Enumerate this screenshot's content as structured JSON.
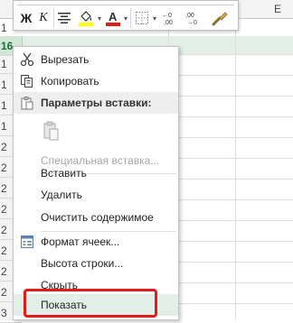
{
  "spreadsheet": {
    "column_visible": "E",
    "rows": [
      "1",
      "16",
      "1",
      "1",
      "1",
      "1",
      "2",
      "2",
      "2",
      "2",
      "2",
      "2",
      "2",
      "2",
      "3",
      "3"
    ],
    "selected_row": "16"
  },
  "toolbar": {
    "bold": "Ж",
    "italic": "К",
    "increase_decimal": "⁺₀₀",
    "decrease_decimal": "₀₀",
    "font_color_glyph": "А"
  },
  "menu": {
    "cut": "Вырезать",
    "copy": "Копировать",
    "paste_options": "Параметры вставки:",
    "paste_special": "Специальная вставка...",
    "insert": "Вставить",
    "delete": "Удалить",
    "clear_contents": "Очистить содержимое",
    "format_cells": "Формат ячеек...",
    "row_height": "Высота строки...",
    "hide": "Скрыть",
    "show": "Показать"
  },
  "colors": {
    "fill_color": "#ffff00",
    "font_color": "#e21b1b",
    "highlight_border": "#e21b1b",
    "selected_row_header": "#d1e7d6"
  }
}
